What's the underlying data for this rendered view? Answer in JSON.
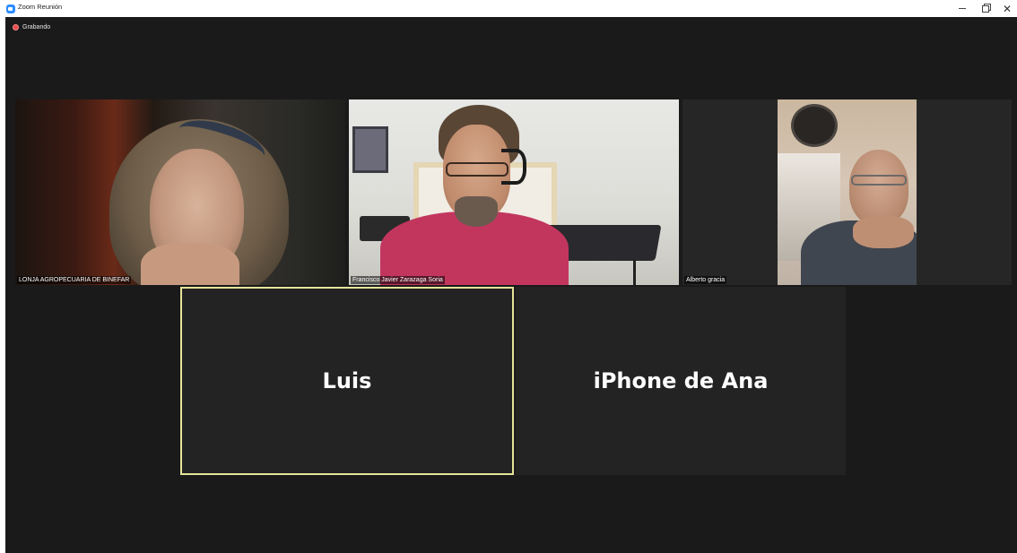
{
  "window": {
    "title": "Zoom Reunión"
  },
  "recording": {
    "label": "Grabando"
  },
  "participants": [
    {
      "name": "LONJA AGROPECUARIA DE BINEFAR",
      "video": true
    },
    {
      "name": "Francisco Javier Zarazaga Soria",
      "video": true
    },
    {
      "name": "Alberto gracia",
      "video": true
    },
    {
      "name": "Luis",
      "video": false,
      "active_speaker": true
    },
    {
      "name": "iPhone de Ana",
      "video": false
    }
  ],
  "colors": {
    "stage_background": "#1a1a1a",
    "tile_background": "#232323",
    "active_speaker_border": "#e4e49a",
    "recording_dot": "#e94b4b"
  }
}
